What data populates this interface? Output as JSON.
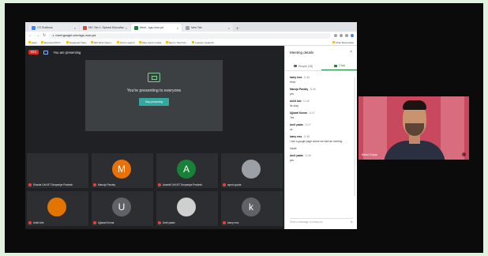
{
  "tabs": [
    {
      "label": "CS Textbook"
    },
    {
      "label": "NIC Tab 1: Special Education"
    },
    {
      "label": "Meet - sgs-ncsn-pd",
      "active": true
    },
    {
      "label": "New Tab"
    }
  ],
  "address": {
    "url": "meet.google.com/sgs-ncsn-pd"
  },
  "bookmarks": [
    "Apps",
    "Received PM P...",
    "Suggested Sites",
    "Wbl Wind Indem...",
    "Scorm search",
    "Data Center Guide",
    "Sign in Touch Ac...",
    "Leanion Lautenth..."
  ],
  "bookmarks_right": [
    "Other Bookmarks"
  ],
  "meet": {
    "rec_label": "REC",
    "presenting_text": "You are presenting",
    "present_title": "You're presenting to everyone",
    "stop_label": "Stop presenting"
  },
  "tiles": [
    {
      "name": "Sharda Cell MT Devpariya Pradesh",
      "avatar": "",
      "color": "#2d2e31"
    },
    {
      "name": "Manoja Pandey",
      "avatar": "M",
      "color": "#e8710a"
    },
    {
      "name": "Awantii Cell MT Devpariya Pradesh",
      "avatar": "A",
      "color": "#188038"
    },
    {
      "name": "ayush gupta",
      "avatar": "",
      "color": "#9aa0a6"
    },
    {
      "name": "Ankit Ade",
      "avatar": "",
      "color": "#e37400"
    },
    {
      "name": "Ujjawal Kumar",
      "avatar": "U",
      "color": "#5f6368"
    },
    {
      "name": "Amit yadav",
      "avatar": "",
      "color": "#cfcfcf"
    },
    {
      "name": "kamy mss",
      "avatar": "k",
      "color": "#5f6368"
    }
  ],
  "details": {
    "title": "Meeting details",
    "people_tab": "People (18)",
    "chat_tab": "Chat",
    "messages": [
      {
        "sender": "kamy mss",
        "time": "11:46",
        "text": "Hello"
      },
      {
        "sender": "Manoja Pandey",
        "time": "11:46",
        "text": "yes"
      },
      {
        "sender": "Ankit Ade",
        "time": "11:46",
        "text": "Its okay"
      },
      {
        "sender": "Ujjawal Kumar",
        "time": "11:47",
        "text": "Yes"
      },
      {
        "sender": "Amit yadav",
        "time": "11:47",
        "text": "ok"
      },
      {
        "sender": "kamy mss",
        "time": "11:48",
        "text": "I see a google page where we start an meeting"
      },
      {
        "sender": "",
        "time": "",
        "text": "Inside"
      },
      {
        "sender": "Amit yadav",
        "time": "11:48",
        "text": "yes"
      }
    ],
    "input_placeholder": "Send a message to everyone"
  },
  "webcam": {
    "name": "Rahul Gupta"
  }
}
